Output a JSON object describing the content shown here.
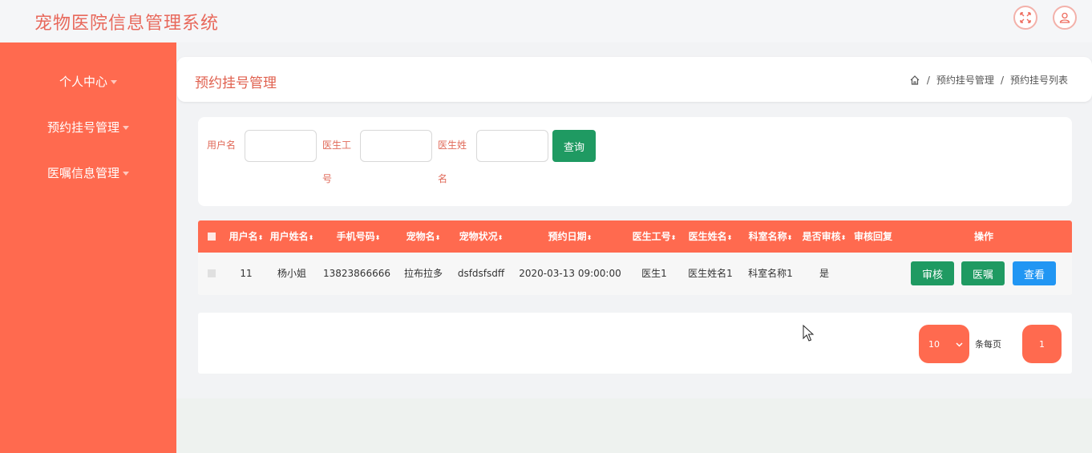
{
  "app": {
    "title": "宠物医院信息管理系统"
  },
  "topbar": {
    "fullscreen_icon": "fullscreen-icon",
    "user_icon": "user-icon"
  },
  "sidebar": {
    "items": [
      {
        "label": "个人中心"
      },
      {
        "label": "预约挂号管理"
      },
      {
        "label": "医嘱信息管理"
      }
    ]
  },
  "header": {
    "title": "预约挂号管理",
    "breadcrumb": [
      "预约挂号管理",
      "预约挂号列表"
    ],
    "separator": "/"
  },
  "search": {
    "fields": [
      {
        "label": "用户名",
        "value": ""
      },
      {
        "label": "医生工号",
        "value": ""
      },
      {
        "label": "医生姓名",
        "value": ""
      }
    ],
    "button": "查询"
  },
  "table": {
    "columns": [
      "用户名",
      "用户姓名",
      "手机号码",
      "宠物名",
      "宠物状况",
      "预约日期",
      "医生工号",
      "医生姓名",
      "科室名称",
      "是否审核",
      "审核回复",
      "操作"
    ],
    "rows": [
      {
        "username": "11",
        "name": "杨小姐",
        "phone": "13823866666",
        "pet": "拉布拉多",
        "pet_status": "dsfdsfsdff",
        "date": "2020-03-13 09:00:00",
        "doctor_id": "医生1",
        "doctor_name": "医生姓名1",
        "dept": "科室名称1",
        "reviewed": "是",
        "reply": ""
      }
    ],
    "actions": [
      "审核",
      "医嘱",
      "查看"
    ]
  },
  "pagination": {
    "page_size": "10",
    "per_page_label": "条每页",
    "current_page": "1"
  },
  "colors": {
    "primary": "#ff6a4f",
    "green": "#1f9a62",
    "blue": "#2196f3"
  }
}
